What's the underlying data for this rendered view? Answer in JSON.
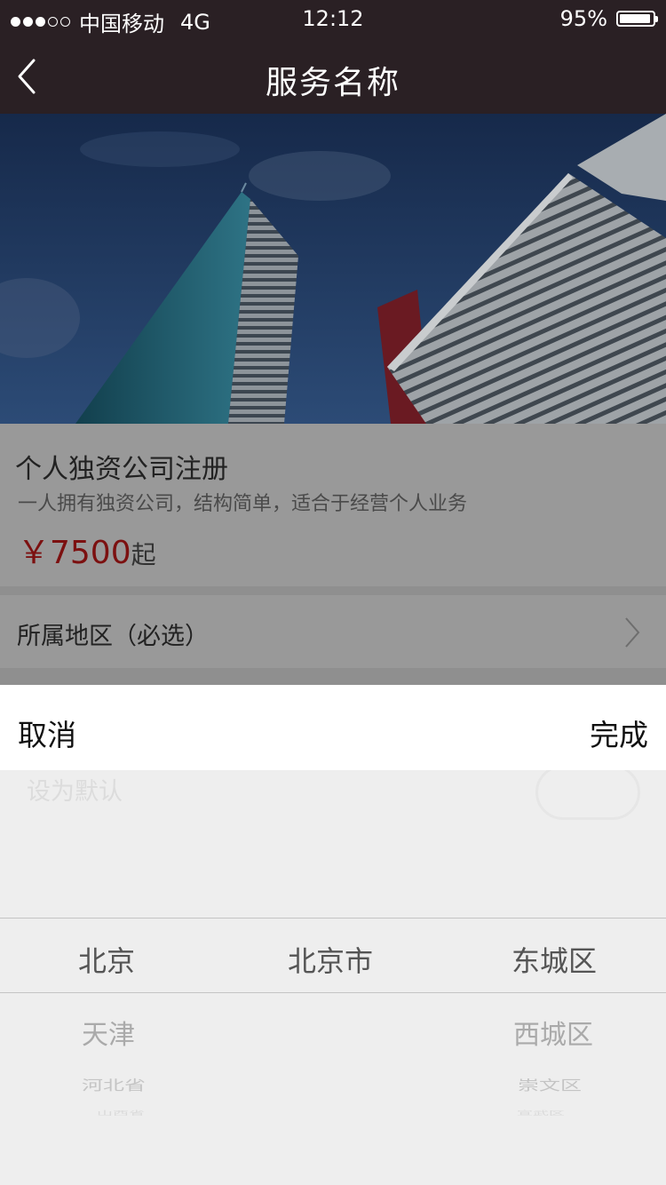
{
  "status_bar": {
    "carrier": "中国移动",
    "network": "4G",
    "time": "12:12",
    "battery_percent": "95%",
    "battery_level": 0.95,
    "signal_bars": 3
  },
  "nav": {
    "title": "服务名称",
    "back_icon": "chevron-left-icon"
  },
  "product": {
    "name": "个人独资公司注册",
    "description": "一人拥有独资公司，结构简单，适合于经营个人业务",
    "price": "￥7500",
    "price_suffix": "起"
  },
  "region": {
    "label": "所属地区（必选）",
    "arrow_icon": "chevron-right-icon"
  },
  "picker": {
    "cancel_label": "取消",
    "done_label": "完成",
    "behind_label": "设为默认",
    "columns": [
      {
        "selected": "北京",
        "next": [
          "天津",
          "河北省",
          "山西省"
        ]
      },
      {
        "selected": "北京市",
        "next": [
          "",
          "",
          ""
        ]
      },
      {
        "selected": "东城区",
        "next": [
          "西城区",
          "崇文区",
          "宣武区"
        ]
      }
    ]
  },
  "colors": {
    "bar_background": "#2a2024",
    "price_color": "#7c1010",
    "picker_background": "#eeeeee"
  }
}
